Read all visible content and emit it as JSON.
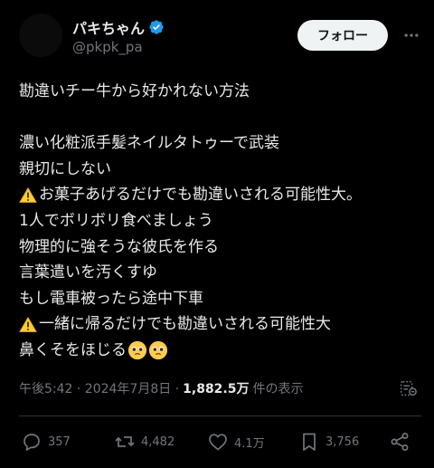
{
  "header": {
    "display_name": "パキちゃん",
    "handle": "@pkpk_pa",
    "follow_label": "フォロー"
  },
  "tweet": {
    "lines": [
      "勘違いチー牛から好かれない方法",
      "",
      "濃い化粧派手髪ネイルタトゥーで武装",
      "親切にしない",
      "お菓子あげるだけでも勘違いされる可能性大。",
      "1人でボリボリ食べましょう",
      "物理的に強そうな彼氏を作る",
      "言葉遣いを汚くすゆ",
      "もし電車被ったら途中下車",
      "一緒に帰るだけでも勘違いされる可能性大",
      "鼻くそをほじる"
    ]
  },
  "meta": {
    "time": "午後5:42 · 2024年7月8日 ·",
    "views_count": "1,882.5万",
    "views_label": "件の表示"
  },
  "actions": {
    "replies": "357",
    "reposts": "4,482",
    "likes": "4.1万",
    "bookmarks": "3,756"
  },
  "colors": {
    "background": "#000000",
    "text": "#e7e9ea",
    "secondary": "#71767b",
    "verified": "#1d9bf0",
    "follow_bg": "#eff3f4"
  }
}
